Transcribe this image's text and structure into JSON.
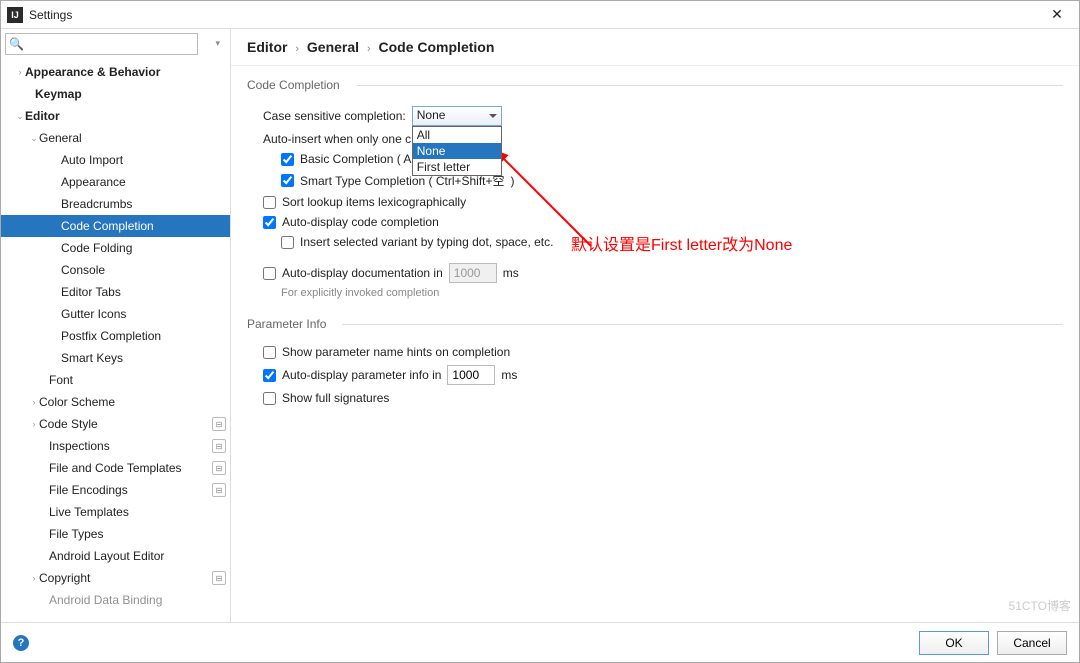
{
  "titlebar": {
    "title": "Settings"
  },
  "search": {
    "placeholder": ""
  },
  "sidebar": {
    "items": [
      {
        "label": "Appearance & Behavior",
        "indent": 14,
        "disc": "›",
        "bold": true
      },
      {
        "label": "Keymap",
        "indent": 24,
        "bold": true
      },
      {
        "label": "Editor",
        "indent": 14,
        "disc": "⌄",
        "bold": true
      },
      {
        "label": "General",
        "indent": 28,
        "disc": "⌄"
      },
      {
        "label": "Auto Import",
        "indent": 50
      },
      {
        "label": "Appearance",
        "indent": 50
      },
      {
        "label": "Breadcrumbs",
        "indent": 50
      },
      {
        "label": "Code Completion",
        "indent": 50,
        "selected": true
      },
      {
        "label": "Code Folding",
        "indent": 50
      },
      {
        "label": "Console",
        "indent": 50
      },
      {
        "label": "Editor Tabs",
        "indent": 50
      },
      {
        "label": "Gutter Icons",
        "indent": 50
      },
      {
        "label": "Postfix Completion",
        "indent": 50
      },
      {
        "label": "Smart Keys",
        "indent": 50
      },
      {
        "label": "Font",
        "indent": 38
      },
      {
        "label": "Color Scheme",
        "indent": 28,
        "disc": "›"
      },
      {
        "label": "Code Style",
        "indent": 28,
        "disc": "›",
        "badge": true
      },
      {
        "label": "Inspections",
        "indent": 38,
        "badge": true
      },
      {
        "label": "File and Code Templates",
        "indent": 38,
        "badge": true
      },
      {
        "label": "File Encodings",
        "indent": 38,
        "badge": true
      },
      {
        "label": "Live Templates",
        "indent": 38
      },
      {
        "label": "File Types",
        "indent": 38
      },
      {
        "label": "Android Layout Editor",
        "indent": 38
      },
      {
        "label": "Copyright",
        "indent": 28,
        "disc": "›",
        "badge": true
      },
      {
        "label": "Android Data Binding",
        "indent": 38,
        "cut": true
      }
    ]
  },
  "breadcrumb": {
    "a": "Editor",
    "b": "General",
    "c": "Code Completion"
  },
  "groups": {
    "code_completion": "Code Completion",
    "parameter_info": "Parameter Info"
  },
  "labels": {
    "case_sensitive": "Case sensitive completion:",
    "auto_insert": "Auto-insert when only one c",
    "basic": "Basic Completion ( A",
    "smart": "Smart Type Completion ( Ctrl+Shift+空",
    "sort_lookup": "Sort lookup items lexicographically",
    "auto_display_code": "Auto-display code completion",
    "insert_variant": "Insert selected variant by typing dot, space, etc.",
    "auto_display_doc": "Auto-display documentation in",
    "doc_hint": "For explicitly invoked completion",
    "show_param_hints": "Show parameter name hints on completion",
    "auto_param_info": "Auto-display parameter info in",
    "show_full_sig": "Show full signatures",
    "ms": "ms"
  },
  "values": {
    "doc_ms": "1000",
    "param_ms": "1000",
    "case_selected": "None",
    "case_options": [
      "All",
      "None",
      "First letter"
    ]
  },
  "checks": {
    "basic": true,
    "smart": true,
    "sort_lookup": false,
    "auto_display_code": true,
    "insert_variant": false,
    "auto_display_doc": false,
    "show_param_hints": false,
    "auto_param_info": true,
    "show_full_sig": false
  },
  "annotation": {
    "text": "默认设置是First letter改为None"
  },
  "footer": {
    "ok": "OK",
    "cancel": "Cancel"
  },
  "watermark": "51CTO博客"
}
